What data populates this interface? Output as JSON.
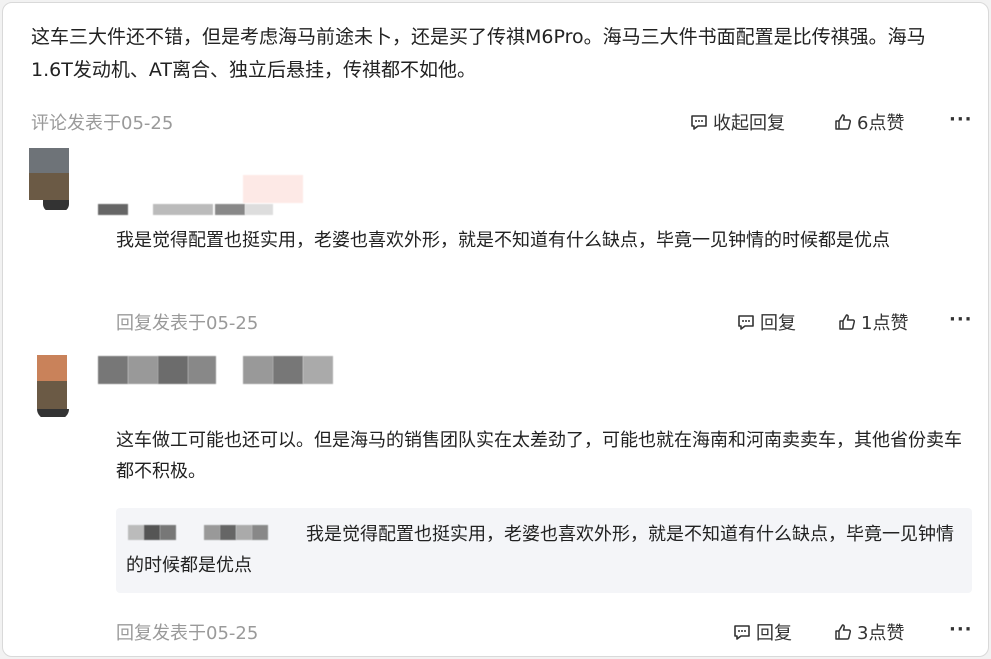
{
  "top_comment": {
    "text": "这车三大件还不错，但是考虑海马前途未卜，还是买了传祺M6Pro。海马三大件书面配置是比传祺强。海马1.6T发动机、AT离合、独立后悬挂，传祺都不如他。",
    "time": "评论发表于05-25",
    "collapse_label": "收起回复",
    "likes_label": "6点赞",
    "more_label": "···"
  },
  "replies": [
    {
      "text": "我是觉得配置也挺实用，老婆也喜欢外形，就是不知道有什么缺点，毕竟一见钟情的时候都是优点",
      "time": "回复发表于05-25",
      "reply_label": "回复",
      "likes_label": "1点赞",
      "more_label": "···"
    },
    {
      "text": "这车做工可能也还可以。但是海马的销售团队实在太差劲了，可能也就在海南和河南卖卖车，其他省份卖车都不积极。",
      "quote_text": "我是觉得配置也挺实用，老婆也喜欢外形，就是不知道有什么缺点，毕竟一见钟情的时候都是优点",
      "time": "回复发表于05-25",
      "reply_label": "回复",
      "likes_label": "3点赞",
      "more_label": "···"
    }
  ],
  "icons": {
    "comment": "comment-bubble-icon",
    "like": "thumbs-up-icon",
    "more": "more-dots-icon"
  },
  "colors": {
    "muted_text": "#9a9a9a",
    "quote_bg": "#f4f5f8"
  }
}
